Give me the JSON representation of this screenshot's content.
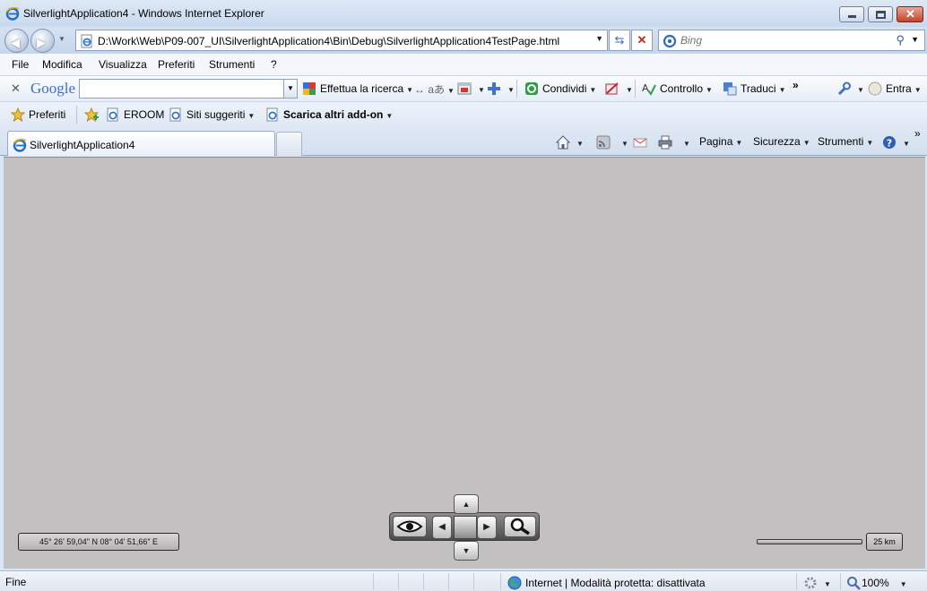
{
  "window": {
    "title": "SilverlightApplication4 - Windows Internet Explorer"
  },
  "address_bar": {
    "url": "D:\\Work\\Web\\P09-007_UI\\SilverlightApplication4\\Bin\\Debug\\SilverlightApplication4TestPage.html"
  },
  "search_box": {
    "placeholder": "Bing"
  },
  "menu": {
    "items": [
      "File",
      "Modifica",
      "Visualizza",
      "Preferiti",
      "Strumenti",
      "?"
    ]
  },
  "google_toolbar": {
    "logo": "Google",
    "search_label": "Effettua la ricerca",
    "share_label": "Condividi",
    "check_label": "Controllo",
    "translate_label": "Traduci",
    "more_label": "»",
    "signin_label": "Entra"
  },
  "favorites_bar": {
    "favorites_label": "Preferiti",
    "items": [
      "EROOM",
      "Siti suggeriti",
      "Scarica altri add-on"
    ]
  },
  "tabs": {
    "active_label": "SilverlightApplication4"
  },
  "command_bar": {
    "page_label": "Pagina",
    "safety_label": "Sicurezza",
    "tools_label": "Strumenti",
    "more_label": "»"
  },
  "map": {
    "coordinates": "45° 26' 59,04\" N 08° 04' 51,66\" E",
    "scale": "25 km"
  },
  "status_bar": {
    "status": "Fine",
    "zone": "Internet | Modalità protetta: disattivata",
    "zoom": "100%"
  }
}
